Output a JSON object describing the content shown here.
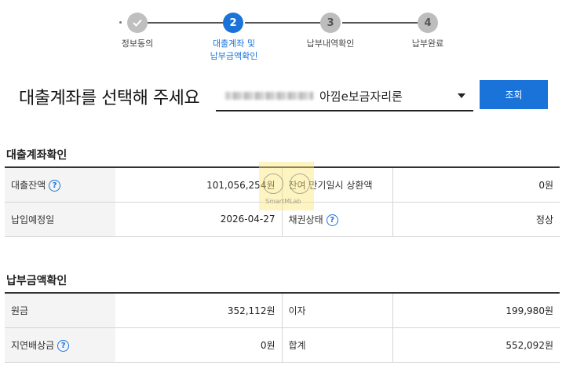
{
  "stepper": {
    "steps": [
      {
        "label": "정보동의",
        "state": "done"
      },
      {
        "label_line1": "대출계좌 및",
        "label_line2": "납부금액확인",
        "number": "2",
        "state": "active"
      },
      {
        "label": "납부내역확인",
        "number": "3",
        "state": "todo"
      },
      {
        "label": "납부완료",
        "number": "4",
        "state": "todo"
      }
    ]
  },
  "header": {
    "title": "대출계좌를 선택해 주세요",
    "selected_account": "아낌e보금자리론",
    "search_label": "조회"
  },
  "loan_confirm": {
    "title": "대출계좌확인",
    "rows": [
      {
        "label1": "대출잔액",
        "value1": "101,056,254원",
        "label2": "잔여 만기일시 상환액",
        "value2": "0원"
      },
      {
        "label1": "납입예정일",
        "value1": "2026-04-27",
        "label2": "채권상태",
        "value2": "정상"
      }
    ]
  },
  "payment_confirm": {
    "title": "납부금액확인",
    "rows": [
      {
        "label1": "원금",
        "value1": "352,112원",
        "label2": "이자",
        "value2": "199,980원"
      },
      {
        "label1": "지연배상금",
        "value1": "0원",
        "label2": "합계",
        "value2": "552,092원"
      }
    ]
  },
  "help_glyph": "?",
  "watermark_text": "SmartMLab",
  "colors": {
    "accent": "#1a73d9",
    "done": "#bfbfbf",
    "todo": "#bdbdbd"
  }
}
